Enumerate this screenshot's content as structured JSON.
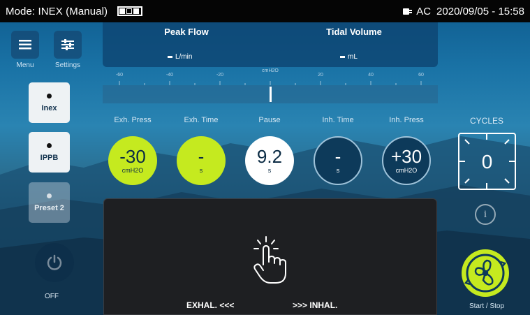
{
  "status_bar": {
    "mode": "Mode: INEX (Manual)",
    "power": "AC",
    "datetime": "2020/09/05 - 15:58"
  },
  "left_menu": {
    "menu_label": "Menu",
    "settings_label": "Settings",
    "modes": [
      {
        "label": "Inex",
        "enabled": true
      },
      {
        "label": "IPPB",
        "enabled": true
      },
      {
        "label": "Preset 2",
        "enabled": false
      }
    ],
    "off_label": "OFF"
  },
  "readout": {
    "peak_flow": {
      "label": "Peak Flow",
      "value": "-",
      "unit": "L/min"
    },
    "tidal_volume": {
      "label": "Tidal Volume",
      "value": "-",
      "unit": "mL"
    }
  },
  "pressure_scale": {
    "unit": "cmH2O",
    "ticks": [
      "-60",
      "-40",
      "-20",
      "0",
      "20",
      "40",
      "60"
    ],
    "current_value": 0
  },
  "parameters": [
    {
      "label": "Exh. Press",
      "value": "-30",
      "unit": "cmH2O",
      "style": "green"
    },
    {
      "label": "Exh. Time",
      "value": "-",
      "unit": "s",
      "style": "green"
    },
    {
      "label": "Pause",
      "value": "9.2",
      "unit": "s",
      "style": "white"
    },
    {
      "label": "Inh. Time",
      "value": "-",
      "unit": "s",
      "style": "dark"
    },
    {
      "label": "Inh. Press",
      "value": "+30",
      "unit": "cmH2O",
      "style": "dark"
    }
  ],
  "cycles": {
    "label": "CYCLES",
    "value": "0"
  },
  "touch_panel": {
    "exhale_label": "EXHAL. <<<",
    "inhale_label": ">>> INHAL."
  },
  "start_stop": {
    "label": "Start / Stop"
  },
  "colors": {
    "accent_green": "#c5ea1f",
    "panel_dark": "#1e1f22",
    "status_bar": "#050505"
  }
}
